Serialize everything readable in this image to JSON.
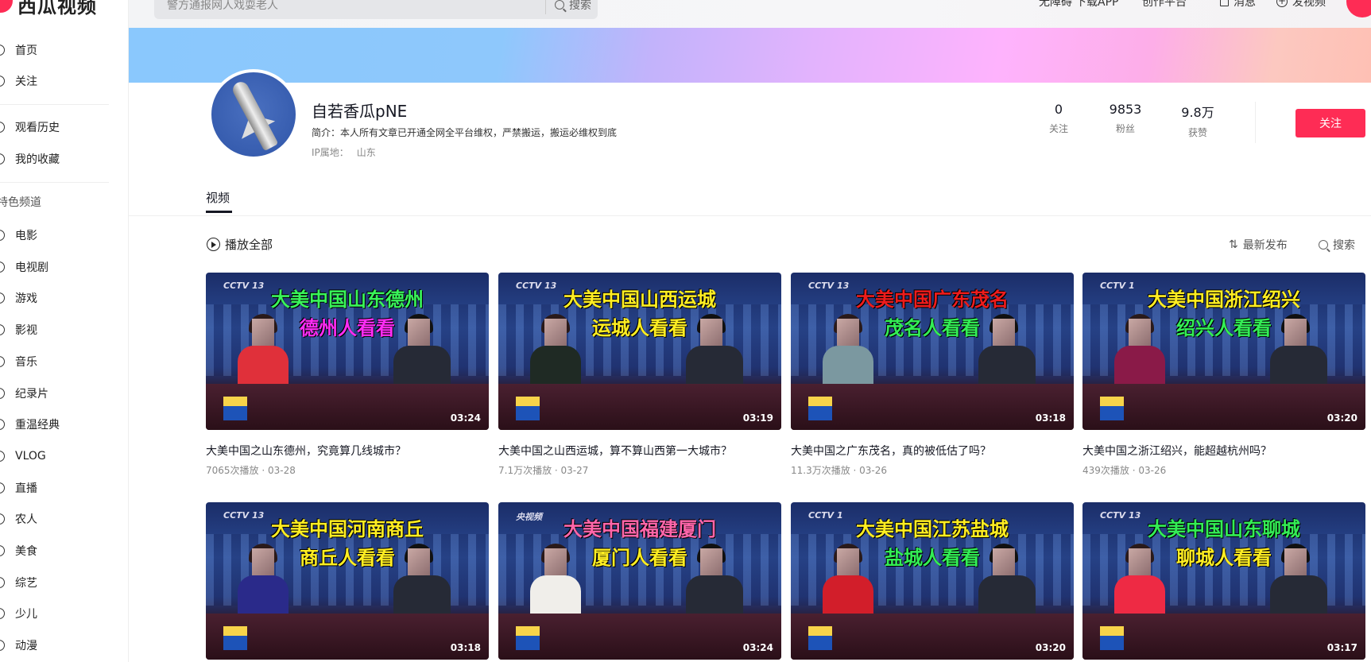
{
  "brand": {
    "logo_text": "西瓜视频",
    "accent": "#fe2c55"
  },
  "sidebar": {
    "top_items": [
      {
        "label": "首页",
        "icon": "home-icon"
      },
      {
        "label": "关注",
        "icon": "heart-icon"
      }
    ],
    "mid_items": [
      {
        "label": "观看历史",
        "icon": "history-icon"
      },
      {
        "label": "我的收藏",
        "icon": "star-icon"
      }
    ],
    "section_title": "特色频道",
    "channels": [
      {
        "label": "电影",
        "icon": "movie-icon"
      },
      {
        "label": "电视剧",
        "icon": "tv-icon"
      },
      {
        "label": "游戏",
        "icon": "game-icon"
      },
      {
        "label": "影视",
        "icon": "film-icon"
      },
      {
        "label": "音乐",
        "icon": "music-icon"
      },
      {
        "label": "纪录片",
        "icon": "documentary-icon"
      },
      {
        "label": "重温经典",
        "icon": "classic-icon"
      },
      {
        "label": "VLOG",
        "icon": "vlog-icon"
      },
      {
        "label": "直播",
        "icon": "live-icon"
      },
      {
        "label": "农人",
        "icon": "farmer-icon"
      },
      {
        "label": "美食",
        "icon": "food-icon"
      },
      {
        "label": "综艺",
        "icon": "variety-icon"
      },
      {
        "label": "少儿",
        "icon": "kids-icon"
      },
      {
        "label": "动漫",
        "icon": "anime-icon"
      }
    ]
  },
  "header": {
    "search_placeholder": "警方通报网人戏耍老人",
    "search_button": "搜索",
    "nav": {
      "accessibility": "无障碍",
      "download": "下载APP",
      "creator": "创作平台",
      "messages": "消息",
      "upload": "发视频"
    }
  },
  "profile": {
    "name": "自若香瓜pNE",
    "intro": "简介：本人所有文章已开通全网全平台维权，严禁搬运，搬运必维权到底",
    "ip_label": "IP属地：",
    "ip_value": "山东",
    "stats": [
      {
        "value": "0",
        "label": "关注"
      },
      {
        "value": "9853",
        "label": "粉丝"
      },
      {
        "value": "9.8万",
        "label": "获赞"
      }
    ],
    "follow_button": "关注"
  },
  "tabs": [
    {
      "label": "视频",
      "active": true
    }
  ],
  "toolbar": {
    "play_all": "播放全部",
    "sort": "最新发布",
    "search": "搜索"
  },
  "videos": [
    {
      "channel": "CCTV 13",
      "caption1": "大美中国山东德州",
      "c1": "#39f55a",
      "caption2": "德州人看看",
      "c2": "#ff2cf5",
      "left_suit": "#e0303a",
      "duration": "03:24",
      "title": "大美中国之山东德州，究竟算几线城市？",
      "meta": "7065次播放 · 03-28"
    },
    {
      "channel": "CCTV 13",
      "caption1": "大美中国山西运城",
      "c1": "#ffee22",
      "caption2": "运城人看看",
      "c2": "#ffee22",
      "left_suit": "#1f2a24",
      "duration": "03:19",
      "title": "大美中国之山西运城，算不算山西第一大城市？",
      "meta": "7.1万次播放 · 03-27"
    },
    {
      "channel": "CCTV 13",
      "caption1": "大美中国广东茂名",
      "c1": "#ee1c1c",
      "caption2": "茂名人看看",
      "c2": "#33ee55",
      "left_suit": "#7b98a0",
      "duration": "03:18",
      "title": "大美中国之广东茂名，真的被低估了吗？",
      "meta": "11.3万次播放 · 03-26"
    },
    {
      "channel": "CCTV 1",
      "caption1": "大美中国浙江绍兴",
      "c1": "#ffee22",
      "caption2": "绍兴人看看",
      "c2": "#33ee55",
      "left_suit": "#8a1a48",
      "duration": "03:20",
      "title": "大美中国之浙江绍兴，能超越杭州吗？",
      "meta": "439次播放 · 03-26"
    },
    {
      "channel": "CCTV 13",
      "caption1": "大美中国河南商丘",
      "c1": "#ffee22",
      "caption2": "商丘人看看",
      "c2": "#ffee22",
      "left_suit": "#2a2a8a",
      "duration": "03:18"
    },
    {
      "channel": "央视频",
      "caption1": "大美中国福建厦门",
      "c1": "#ff66aa",
      "caption2": "厦门人看看",
      "c2": "#ffee22",
      "left_suit": "#f0eeea",
      "duration": "03:24"
    },
    {
      "channel": "CCTV 1",
      "caption1": "大美中国江苏盐城",
      "c1": "#ffee22",
      "caption2": "盐城人看看",
      "c2": "#33ee55",
      "left_suit": "#d21e2a",
      "duration": "03:20"
    },
    {
      "channel": "CCTV 13",
      "caption1": "大美中国山东聊城",
      "c1": "#33ee55",
      "caption2": "聊城人看看",
      "c2": "#ffee22",
      "left_suit": "#ee2a44",
      "duration": "03:17"
    }
  ]
}
